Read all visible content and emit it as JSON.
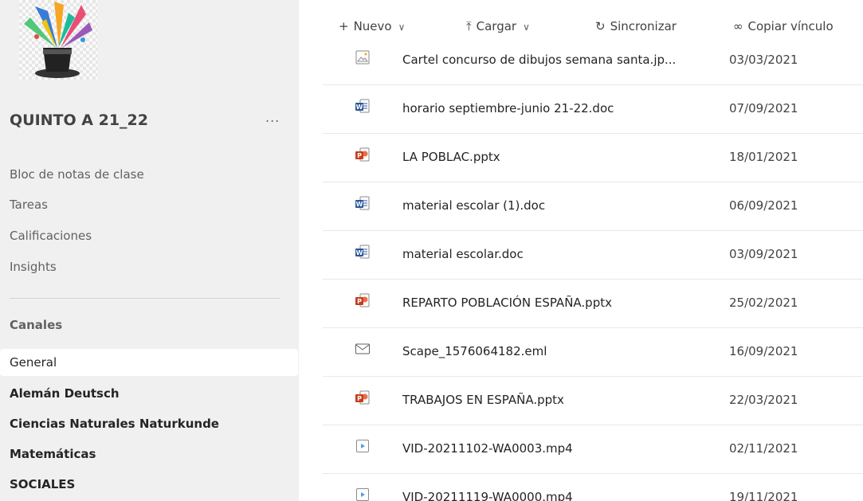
{
  "sidebar": {
    "team_name": "QUINTO A 21_22",
    "more_label": "...",
    "nav": [
      "Bloc de notas de clase",
      "Tareas",
      "Calificaciones",
      "Insights"
    ],
    "channels_label": "Canales",
    "channels": [
      {
        "label": "General",
        "selected": true,
        "bold": false
      },
      {
        "label": "Alemán Deutsch",
        "selected": false,
        "bold": true
      },
      {
        "label": "Ciencias Naturales Naturkunde",
        "selected": false,
        "bold": true
      },
      {
        "label": "Matemáticas",
        "selected": false,
        "bold": true
      },
      {
        "label": "SOCIALES",
        "selected": false,
        "bold": true
      }
    ]
  },
  "toolbar": {
    "new_label": "Nuevo",
    "upload_label": "Cargar",
    "sync_label": "Sincronizar",
    "copy_link_label": "Copiar vínculo"
  },
  "files": [
    {
      "name": "Cartel concurso de dibujos semana santa.jp...",
      "date": "03/03/2021",
      "icon": "image-file-icon"
    },
    {
      "name": "horario septiembre-junio 21-22.doc",
      "date": "07/09/2021",
      "icon": "word-file-icon"
    },
    {
      "name": "LA POBLAC.pptx",
      "date": "18/01/2021",
      "icon": "powerpoint-file-icon"
    },
    {
      "name": "material escolar (1).doc",
      "date": "06/09/2021",
      "icon": "word-file-icon"
    },
    {
      "name": "material escolar.doc",
      "date": "03/09/2021",
      "icon": "word-file-icon"
    },
    {
      "name": "REPARTO POBLACIÓN ESPAÑA.pptx",
      "date": "25/02/2021",
      "icon": "powerpoint-file-icon"
    },
    {
      "name": "Scape_1576064182.eml",
      "date": "16/09/2021",
      "icon": "email-file-icon"
    },
    {
      "name": "TRABAJOS EN ESPAÑA.pptx",
      "date": "22/03/2021",
      "icon": "powerpoint-file-icon"
    },
    {
      "name": "VID-20211102-WA0003.mp4",
      "date": "02/11/2021",
      "icon": "video-file-icon"
    },
    {
      "name": "VID-20211119-WA0000.mp4",
      "date": "19/11/2021",
      "icon": "video-file-icon"
    }
  ],
  "colors": {
    "word": "#2b579a",
    "powerpoint": "#c43e1c",
    "sidebar_bg": "#f0f0f0"
  }
}
